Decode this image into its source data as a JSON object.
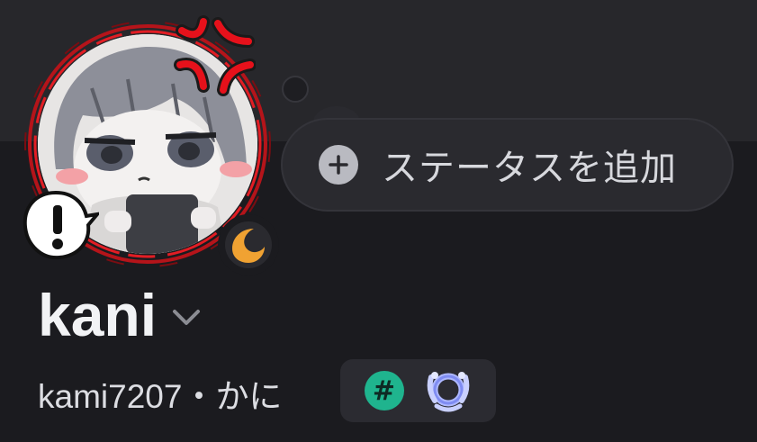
{
  "profile": {
    "display_name": "kani",
    "username": "kami7207",
    "separator": "・",
    "pronouns": "かに"
  },
  "status": {
    "add_label": "ステータスを追加",
    "presence": "idle"
  },
  "badges": [
    {
      "icon": "hashtag-icon",
      "text": "#",
      "color": "#1fb48e"
    },
    {
      "icon": "laurel-wreath-icon",
      "color": "#a9b4ff"
    }
  ],
  "colors": {
    "background": "#1b1b1f",
    "banner": "#27272b",
    "idle": "#f0a232",
    "decoration": "#d4161c"
  }
}
